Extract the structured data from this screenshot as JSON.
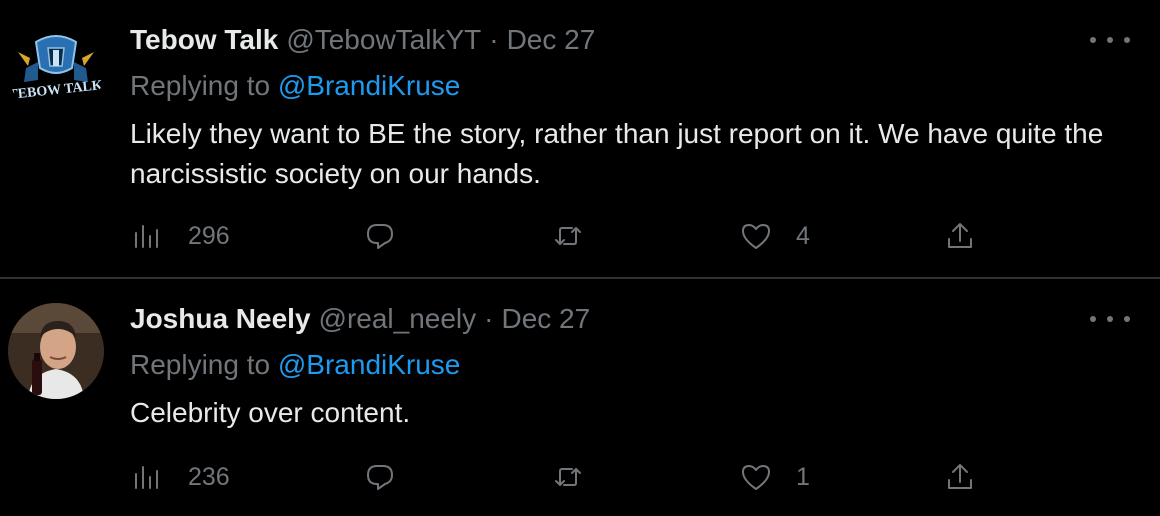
{
  "tweets": [
    {
      "name": "Tebow Talk",
      "handle": "@TebowTalkYT",
      "separator": "·",
      "date": "Dec 27",
      "replying_prefix": "Replying to",
      "replying_to": "@BrandiKruse",
      "text": "Likely they want to BE the story, rather than just report on it. We have quite the narcissistic society on our hands.",
      "views": "296",
      "likes": "4",
      "avatar_logo_text": "TEBOW TALK"
    },
    {
      "name": "Joshua Neely",
      "handle": "@real_neely",
      "separator": "·",
      "date": "Dec 27",
      "replying_prefix": "Replying to",
      "replying_to": "@BrandiKruse",
      "text": "Celebrity over content.",
      "views": "236",
      "likes": "1"
    }
  ],
  "icons": {
    "views": "bar-chart-icon",
    "reply": "speech-bubble-icon",
    "retweet": "retweet-icon",
    "like": "heart-icon",
    "share": "share-icon",
    "more": "ellipsis-icon"
  },
  "colors": {
    "background": "#000000",
    "text": "#e7e9ea",
    "muted": "#71767b",
    "link": "#1d9bf0",
    "divider": "#2f3336"
  }
}
